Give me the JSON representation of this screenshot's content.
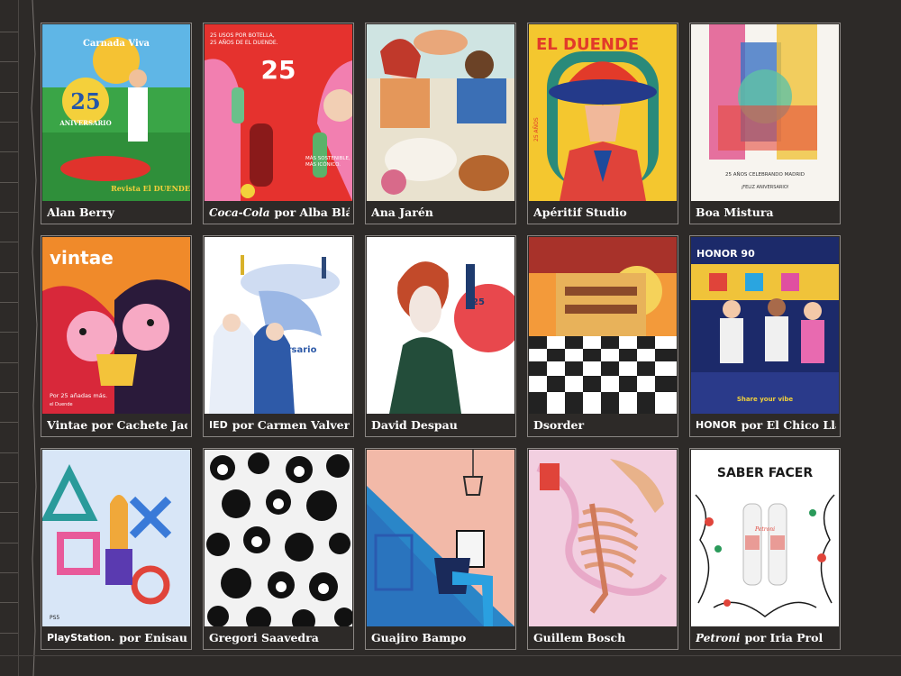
{
  "colors": {
    "background": "#2d2a28",
    "border": "#8a8683",
    "caption": "#ffffff"
  },
  "cards": [
    {
      "artist": "Alan Berry",
      "art_text": [
        "Carnada Viva",
        "25",
        "ANIVERSARIO",
        "Revista El DUENDE"
      ]
    },
    {
      "brand": "Coca-Cola",
      "artist": "por Alba Blázquez",
      "art_text": [
        "25 USOS POR BOTELLA,",
        "25 AÑOS DE EL DUENDE.",
        "25",
        "MÁS SOSTENIBLE,",
        "MÁS ICÓNICO."
      ]
    },
    {
      "artist": "Ana Jarén",
      "art_text": []
    },
    {
      "artist": "Apéritif Studio",
      "art_text": [
        "EL DUENDE",
        "25 AÑOS"
      ]
    },
    {
      "artist": "Boa Mistura",
      "art_text": [
        "25 AÑOS CELEBRANDO MADRID",
        "¡FELIZ ANIVERSARIO!"
      ]
    },
    {
      "artist": "Vintae por Cachete Jack",
      "art_text": [
        "vintae",
        "Por 25 añadas más.",
        "el Duende"
      ]
    },
    {
      "brand": "IED",
      "artist": "por Carmen Valverde",
      "art_text": [
        "Aniversario"
      ]
    },
    {
      "artist": "David Despau",
      "art_text": [
        "25"
      ]
    },
    {
      "artist": "Dsorder",
      "art_text": []
    },
    {
      "brand": "HONOR",
      "artist": "por El Chico Llama",
      "art_text": [
        "HONOR 90",
        "Share your vibe"
      ]
    },
    {
      "brand": "PlayStation.",
      "artist": "por Enisaurus",
      "art_text": [
        "PS5"
      ]
    },
    {
      "artist": "Gregori Saavedra",
      "art_text": []
    },
    {
      "artist": "Guajiro Bampo",
      "art_text": []
    },
    {
      "artist": "Guillem Bosch",
      "art_text": []
    },
    {
      "brand": "Petroni",
      "artist": "por Iria Prol",
      "art_text": [
        "SABER FACER",
        "Petroni"
      ]
    }
  ]
}
